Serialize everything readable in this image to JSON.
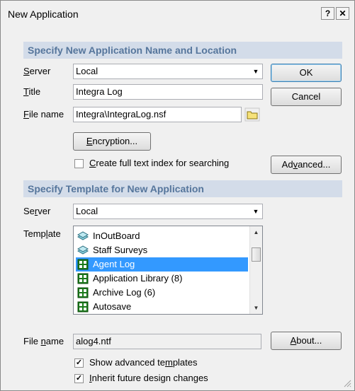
{
  "window": {
    "title": "New Application",
    "help_button": "?",
    "close_button": "✕"
  },
  "section_name": {
    "header": "Specify New Application Name and Location"
  },
  "server": {
    "label": "Server",
    "value": "Local"
  },
  "title_field": {
    "label": "Title",
    "value": "Integra Log"
  },
  "file_name": {
    "label": "File name",
    "value": "Integra\\IntegraLog.nsf"
  },
  "buttons": {
    "ok": "OK",
    "cancel": "Cancel",
    "encryption": "Encryption...",
    "advanced": "Advanced...",
    "about": "About..."
  },
  "full_text_index": {
    "label": "Create full text index for searching",
    "checked": false
  },
  "section_template": {
    "header": "Specify Template for New Application"
  },
  "template_server": {
    "label": "Server",
    "value": "Local"
  },
  "template": {
    "label": "Template",
    "items": [
      {
        "label": "InOutBoard",
        "icon": "database-stack-icon"
      },
      {
        "label": "Staff Surveys",
        "icon": "database-stack-icon"
      },
      {
        "label": "Agent Log",
        "icon": "template-grid-icon"
      },
      {
        "label": "Application Library (8)",
        "icon": "template-grid-icon"
      },
      {
        "label": "Archive Log (6)",
        "icon": "template-grid-icon"
      },
      {
        "label": "Autosave",
        "icon": "template-grid-icon"
      }
    ],
    "selected": "Agent Log"
  },
  "template_file_name": {
    "label": "File name",
    "value": "alog4.ntf"
  },
  "show_advanced_templates": {
    "label": "Show advanced templates",
    "checked": true
  },
  "inherit_design": {
    "label": "Inherit future design changes",
    "checked": true
  },
  "colors": {
    "section_header_bg": "#d3dce9",
    "section_header_text": "#56769c",
    "selection": "#3399ff",
    "icon_green": "#1a7a1a",
    "icon_teal": "#4aa7b8"
  }
}
